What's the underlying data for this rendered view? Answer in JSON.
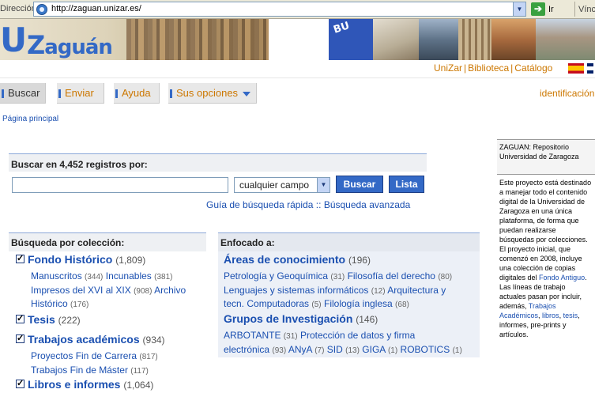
{
  "browser": {
    "address_label": "Dirección",
    "url": "http://zaguan.unizar.es/",
    "go_label": "Ir",
    "links_label": "Vínculos"
  },
  "header": {
    "logo_u": "U",
    "logo_z": "Z",
    "logo_rest": "aguán",
    "photo_text": "BU",
    "links": [
      "UniZar",
      "Biblioteca",
      "Catálogo"
    ]
  },
  "nav": {
    "items": [
      "Buscar",
      "Enviar",
      "Ayuda",
      "Sus opciones"
    ],
    "login": "identificación"
  },
  "breadcrumb": "Página principal",
  "search": {
    "heading": "Buscar en 4,452 registros por:",
    "input_value": "",
    "field_select": "cualquier campo",
    "search_button": "Buscar",
    "list_button": "Lista",
    "quick_guide": "Guía de búsqueda rápida",
    "separator": "::",
    "advanced": "Búsqueda avanzada"
  },
  "collections": {
    "heading": "Búsqueda por colección:",
    "items": [
      {
        "title": "Fondo Histórico",
        "count": "(1,809)"
      },
      {
        "title": "Tesis",
        "count": "(222)"
      },
      {
        "title": "Trabajos académicos",
        "count": "(934)"
      },
      {
        "title": "Libros e informes",
        "count": "(1,064)"
      }
    ],
    "fondo_subs": [
      {
        "label": "Manuscritos",
        "count": "(344)"
      },
      {
        "label": "Incunables",
        "count": "(381)"
      },
      {
        "label": "Impresos del XVI al XIX",
        "count": "(908)"
      },
      {
        "label": "Archivo",
        "count": ""
      },
      {
        "label": "Histórico",
        "count": "(176)"
      }
    ],
    "trabajos_subs": [
      {
        "label": "Proyectos Fin de Carrera",
        "count": "(817)"
      },
      {
        "label": "Trabajos Fin de Máster",
        "count": "(117)"
      }
    ]
  },
  "focused": {
    "heading": "Enfocado a:",
    "areas_title": "Áreas de conocimiento",
    "areas_count": "(196)",
    "areas": [
      {
        "label": "Petrología y Geoquímica",
        "count": "(31)"
      },
      {
        "label": "Filosofía del derecho",
        "count": "(80)"
      },
      {
        "label": "Lenguajes y sistemas informáticos",
        "count": "(12)"
      },
      {
        "label": "Arquitectura y",
        "count": ""
      },
      {
        "label": "tecn. Computadoras",
        "count": "(5)"
      },
      {
        "label": "Filología inglesa",
        "count": "(68)"
      }
    ],
    "groups_title": "Grupos de Investigación",
    "groups_count": "(146)",
    "groups": [
      {
        "label": "ARBOTANTE",
        "count": "(31)"
      },
      {
        "label": "Protección de datos y firma",
        "count": ""
      },
      {
        "label": "electrónica",
        "count": "(93)"
      },
      {
        "label": "ANyA",
        "count": "(7)"
      },
      {
        "label": "SID",
        "count": "(13)"
      },
      {
        "label": "GIGA",
        "count": "(1)"
      },
      {
        "label": "ROBOTICS",
        "count": "(1)"
      }
    ]
  },
  "sidebar": {
    "title": "ZAGUAN: Repositorio Universidad de Zaragoza",
    "body_1": "Este proyecto está destinado a manejar todo el contenido digital de la Universidad de Zaragoza en una única plataforma, de forma que puedan realizarse búsquedas por colecciones. El proyecto inicial, que comenzó en 2008, incluye una colección de copias digitales del ",
    "link_1": "Fondo Antiguo",
    "body_2": ". Las líneas de trabajo actuales pasan por incluir, además, ",
    "link_2": "Trabajos Académicos",
    "comma_1": ", ",
    "link_3": "libros",
    "comma_2": ", ",
    "link_4": "tesis",
    "body_3": ", informes, pre-prints y artículos."
  },
  "colors": {
    "accent_blue": "#3369c6",
    "link_blue": "#1a4fb0",
    "orange": "#cc7700"
  }
}
